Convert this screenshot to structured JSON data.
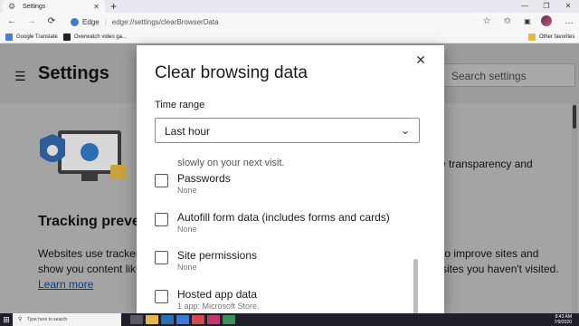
{
  "browser": {
    "tab_title": "Settings",
    "tab_close": "✕",
    "new_tab": "+",
    "window_controls": [
      "—",
      "❐",
      "✕"
    ],
    "nav": {
      "back": "←",
      "forward": "→",
      "refresh": "⟳"
    },
    "address": {
      "host": "Edge",
      "separator": "|",
      "url": "edge://settings/clearBrowserData"
    },
    "toolbar_icons": [
      "star-icon",
      "favorites-icon",
      "collections-icon",
      "profile-avatar"
    ],
    "favorites": [
      {
        "label": "Google Translate",
        "color": "#4a7dd9"
      },
      {
        "label": "Overwatch video ga...",
        "color": "#222222"
      }
    ],
    "other_favorites": "Other favorites"
  },
  "settings_page": {
    "title": "Settings",
    "search_placeholder": "Search settings",
    "tracking_heading": "Tracking preve",
    "desc_line1": "Websites use tracker",
    "desc_line2": "show you content lik",
    "learn_more": "Learn more",
    "right_text1": "e transparency and",
    "right_text2": "to improve sites and",
    "right_text3": "sites you haven't visited."
  },
  "dialog": {
    "title": "Clear browsing data",
    "close": "✕",
    "time_range_label": "Time range",
    "time_range_value": "Last hour",
    "partial_top_text": "slowly on your next visit.",
    "items": [
      {
        "label": "Passwords",
        "sub": "None",
        "checked": false
      },
      {
        "label": "Autofill form data (includes forms and cards)",
        "sub": "None",
        "checked": false
      },
      {
        "label": "Site permissions",
        "sub": "None",
        "checked": false
      },
      {
        "label": "Hosted app data",
        "sub": "1 app: Microsoft Store.",
        "checked": false
      }
    ]
  },
  "taskbar": {
    "search_placeholder": "Type here to search",
    "time": "8:43 AM",
    "date": "7/9/2020"
  }
}
